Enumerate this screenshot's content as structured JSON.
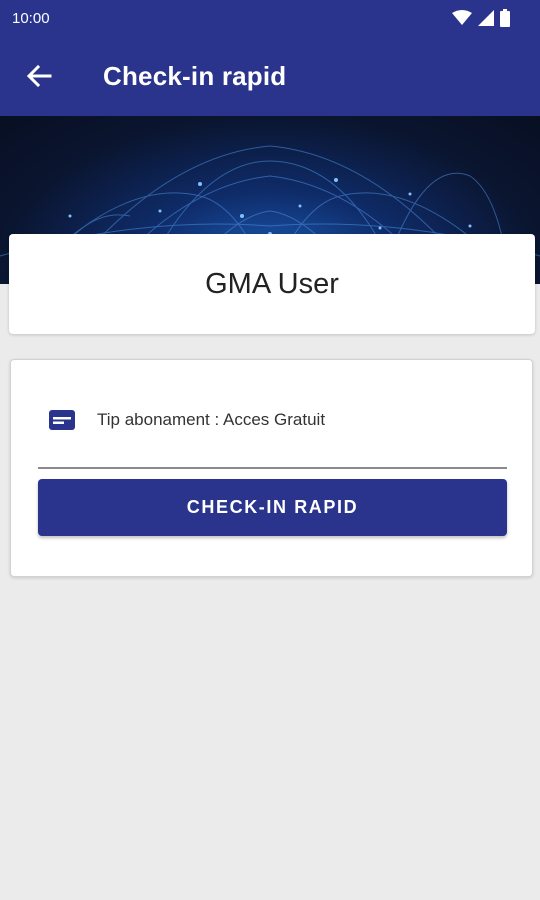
{
  "status_bar": {
    "time": "10:00",
    "icons": [
      "wifi-icon",
      "signal-icon",
      "battery-icon"
    ]
  },
  "app_bar": {
    "back_icon": "arrow-back-icon",
    "title": "Check-in rapid"
  },
  "user_card": {
    "name": "GMA User"
  },
  "subscription_card": {
    "icon": "card-icon",
    "type_text": "Tip abonament : Acces Gratuit",
    "checkin_button_label": "CHECK-IN RAPID"
  },
  "colors": {
    "primary": "#2a348c",
    "background": "#ebebeb",
    "card": "#ffffff"
  }
}
